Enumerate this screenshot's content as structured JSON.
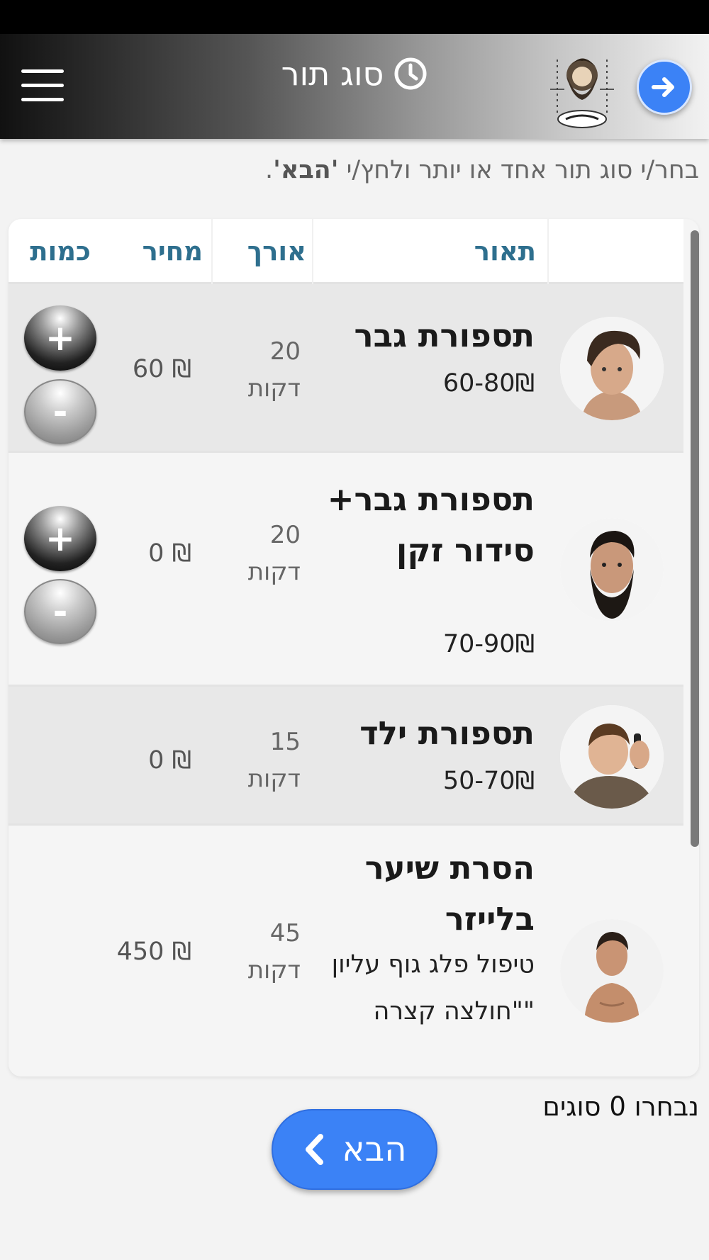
{
  "header": {
    "title": "סוג תור",
    "menu_icon": "hamburger-menu-icon",
    "clock_icon": "clock-icon",
    "logo_icon": "barber-logo-icon",
    "next_icon": "arrow-right-icon"
  },
  "instruction": {
    "prefix": "בחר/י סוג תור אחד או יותר ולחץ/י ",
    "highlight": "'הבא'",
    "suffix": "."
  },
  "table": {
    "columns": {
      "description": "תאור",
      "length": "אורך",
      "price": "מחיר",
      "quantity": "כמות"
    },
    "rows": [
      {
        "title": "תספורת גבר",
        "subtitle": "60-80₪",
        "length_value": "20",
        "length_unit": "דקות",
        "price": "60 ₪",
        "has_quantity": true,
        "photo_icon": "man-haircut-photo"
      },
      {
        "title": "תספורת גבר+ סידור זקן",
        "subtitle": "70-90₪",
        "length_value": "20",
        "length_unit": "דקות",
        "price": "0 ₪",
        "has_quantity": true,
        "photo_icon": "bearded-man-photo"
      },
      {
        "title": "תספורת ילד",
        "subtitle": "50-70₪",
        "length_value": "15",
        "length_unit": "דקות",
        "price": "0 ₪",
        "has_quantity": false,
        "photo_icon": "boy-haircut-photo"
      },
      {
        "title": "הסרת שיער בלייזר",
        "subtitle": "טיפול פלג גוף עליון \"חולצה קצרה\"",
        "length_value": "45",
        "length_unit": "דקות",
        "price": "450 ₪",
        "has_quantity": false,
        "photo_icon": "laser-hair-removal-photo"
      }
    ],
    "plus_label": "+",
    "minus_label": "-"
  },
  "footer": {
    "selected_text": "נבחרו 0 סוגים",
    "next_label": "הבא",
    "next_icon": "chevron-left-icon"
  },
  "colors": {
    "accent": "#3b82f6",
    "header_text": "#2e6f8e"
  }
}
